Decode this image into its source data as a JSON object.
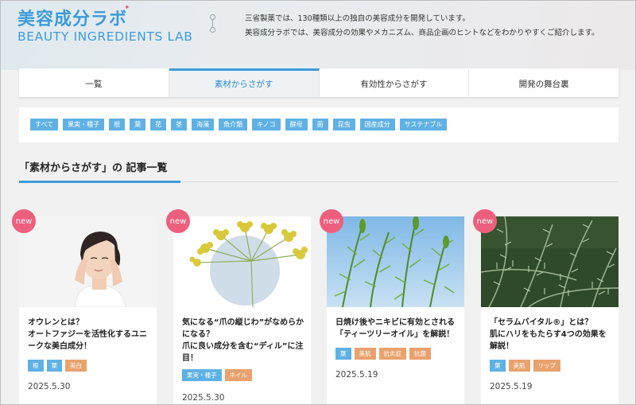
{
  "header": {
    "logo_jp": "美容成分ラボ",
    "logo_en": "BEAUTY INGREDIENTS LAB",
    "tagline_line1": "三省製薬では、130種類以上の独自の美容成分を開発しています。",
    "tagline_line2": "美容成分ラボでは、美容成分の効果やメカニズム、商品企画のヒントなどをわかりやすくご紹介します。"
  },
  "tabs": [
    {
      "label": "一覧",
      "active": false
    },
    {
      "label": "素材からさがす",
      "active": true
    },
    {
      "label": "有効性からさがす",
      "active": false
    },
    {
      "label": "開発の舞台裏",
      "active": false
    }
  ],
  "filter_tags": [
    "すべて",
    "果実・種子",
    "根",
    "葉",
    "花",
    "茎",
    "海藻",
    "魚介類",
    "キノコ",
    "酵母",
    "菌",
    "昆虫",
    "国産成分",
    "サステナブル"
  ],
  "section": {
    "title": "「素材からさがす」の 記事一覧"
  },
  "colors": {
    "accent": "#3d9bd9",
    "tag_blue": "#5fb1e4",
    "tag_orange": "#e9a26d",
    "new_badge": "#ee5f7d"
  },
  "cards": [
    {
      "badge": "new",
      "image": "woman-portrait",
      "title": "オウレンとは？\nオートファジーを活性化するユニークな美白成分！",
      "tags": [
        {
          "label": "根",
          "color": "blue"
        },
        {
          "label": "葉",
          "color": "blue"
        },
        {
          "label": "美白",
          "color": "orange"
        }
      ],
      "date": "2025.5.30"
    },
    {
      "badge": "new",
      "image": "dill-flower",
      "title": "気になる“爪の縦じわ”がなめらかになる？\n爪に良い成分を含む“ディル”に注目！",
      "tags": [
        {
          "label": "果実・種子",
          "color": "blue"
        },
        {
          "label": "ネイル",
          "color": "orange"
        }
      ],
      "date": "2025.5.30"
    },
    {
      "badge": "new",
      "image": "tea-tree",
      "title": "日焼け後やニキビに有効とされる「ティーツリーオイル」を解説！",
      "tags": [
        {
          "label": "葉",
          "color": "blue"
        },
        {
          "label": "美肌",
          "color": "orange"
        },
        {
          "label": "抗炎症",
          "color": "orange"
        },
        {
          "label": "抗菌",
          "color": "orange"
        }
      ],
      "date": "2025.5.19"
    },
    {
      "badge": "new",
      "image": "rosemary",
      "title": "「セラムバイタル®」とは？\n肌にハリをもたらす4つの効果を解説！",
      "tags": [
        {
          "label": "葉",
          "color": "blue"
        },
        {
          "label": "美肌",
          "color": "orange"
        },
        {
          "label": "リップ",
          "color": "orange"
        }
      ],
      "date": "2025.5.19"
    }
  ]
}
